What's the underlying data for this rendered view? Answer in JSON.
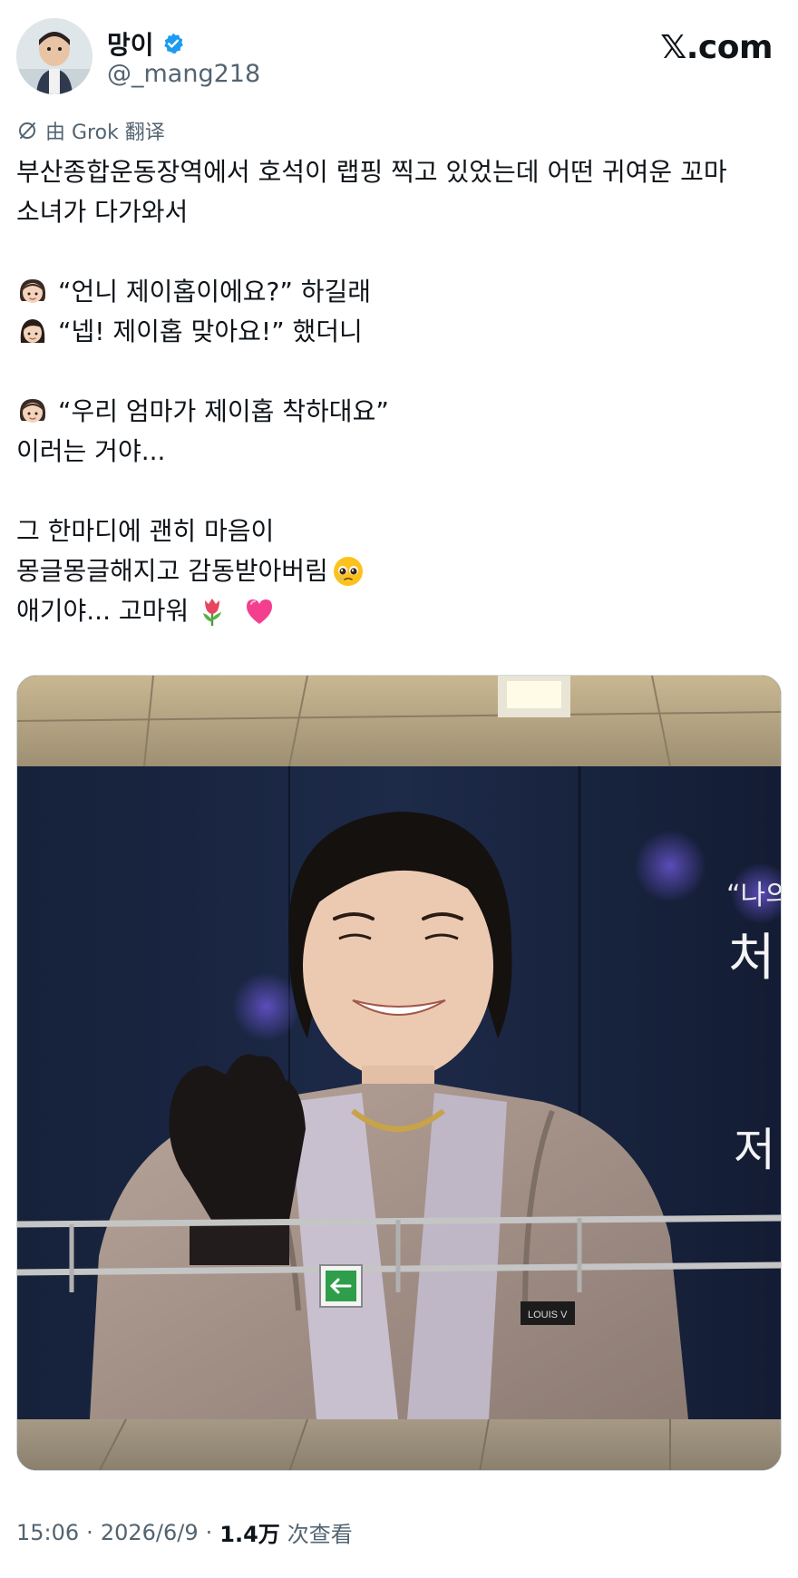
{
  "author": {
    "name": "망이",
    "handle": "@_mang218",
    "verified": true
  },
  "brand": "𝕏.com",
  "translation_label": "由 Grok 翻译",
  "tweet_lines": [
    "부산종합운동장역에서 호석이 랩핑 찍고 있었는데 어떤 귀여운 꼬마",
    "소녀가 다가와서",
    "",
    "“언니 제이홉이에요?” 하길래",
    "“넵! 제이홉 맞아요!” 했더니",
    "",
    "“우리 엄마가 제이홉 착하대요”",
    "이러는 거야...",
    "",
    "그 한마디에 괜히 마음이",
    "몽글몽글해지고 감동받아버림",
    "애기야... 고마워"
  ],
  "emojis": {
    "girl": "👧🏻",
    "woman": "👩🏻",
    "pleading": "🥹",
    "tulip": "🌷",
    "heart": "💗"
  },
  "media": {
    "sign_text_1": "“나의",
    "sign_text_2": "처",
    "sign_text_3": "저",
    "brand_on_jacket": "LOUIS V"
  },
  "meta": {
    "time": "15:06",
    "date": "2026/6/9",
    "views_count": "1.4万",
    "views_label": "次查看",
    "separator": "·"
  },
  "colors": {
    "verified": "#1d9bf0",
    "secondary_text": "#536471",
    "primary_text": "#0f1419"
  }
}
